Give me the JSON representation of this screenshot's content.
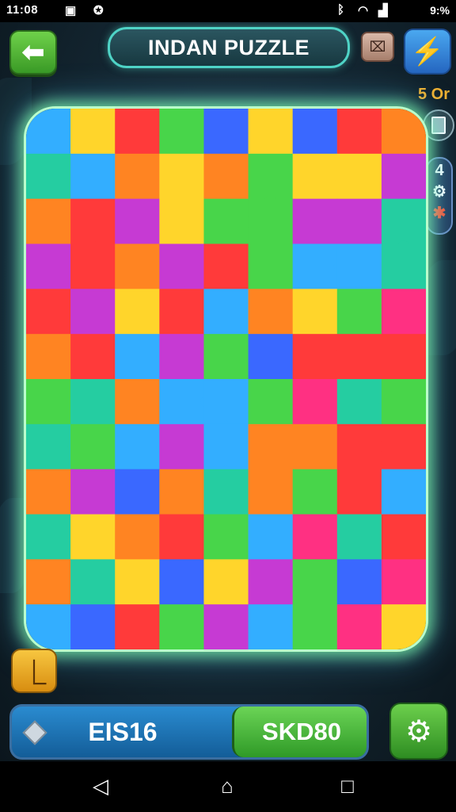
{
  "status_bar": {
    "time": "11:08",
    "icons": [
      "gallery-icon",
      "app-icon"
    ],
    "right_icons": [
      "bluetooth-icon",
      "wifi-icon",
      "signal-icon"
    ],
    "battery": "9:%"
  },
  "header": {
    "back_icon": "arrow-left-icon",
    "title": "INDAN PUZZLE",
    "small_button_icon": "map-icon",
    "hint_button_icon": "lightning-icon"
  },
  "side_panel": {
    "counter": "5 Or",
    "card_icon": "card-icon",
    "pill_items": [
      "4",
      "⚙",
      "✱"
    ]
  },
  "board": {
    "colors": [
      "#ff2a2a",
      "#ff7a10",
      "#ffd21a",
      "#39d23b",
      "#22a8ff",
      "#2a5cff",
      "#c22ad0",
      "#ff1f78",
      "#13c99a"
    ]
  },
  "bottom": {
    "left_button_icon": "book-icon",
    "score_left": "EIS16",
    "score_right": "SKD80",
    "settings_icon": "gear-icon"
  },
  "nav": [
    "back-nav-icon",
    "home-nav-icon",
    "recents-nav-icon"
  ]
}
